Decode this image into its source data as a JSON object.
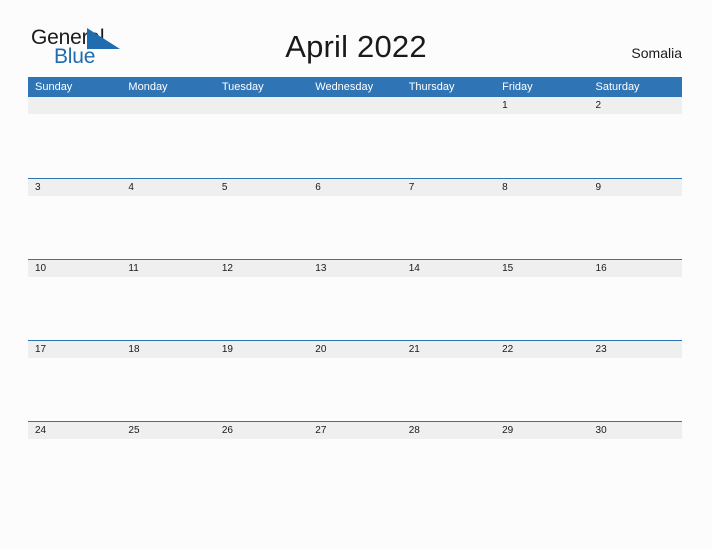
{
  "branding": {
    "logo_text_primary": "General",
    "logo_text_secondary": "Blue",
    "logo_icon": "triangle-flag-icon",
    "accent_color": "#2f74b5",
    "logo_blue": "#1f6cb0"
  },
  "header": {
    "title": "April 2022",
    "region": "Somalia"
  },
  "calendar": {
    "month": "April",
    "year": "2022",
    "weekday_headers": [
      "Sunday",
      "Monday",
      "Tuesday",
      "Wednesday",
      "Thursday",
      "Friday",
      "Saturday"
    ],
    "header_bg": "#2f74b5",
    "day_band_bg": "#efefef",
    "weeks": [
      [
        "",
        "",
        "",
        "",
        "",
        "1",
        "2"
      ],
      [
        "3",
        "4",
        "5",
        "6",
        "7",
        "8",
        "9"
      ],
      [
        "10",
        "11",
        "12",
        "13",
        "14",
        "15",
        "16"
      ],
      [
        "17",
        "18",
        "19",
        "20",
        "21",
        "22",
        "23"
      ],
      [
        "24",
        "25",
        "26",
        "27",
        "28",
        "29",
        "30"
      ]
    ]
  }
}
